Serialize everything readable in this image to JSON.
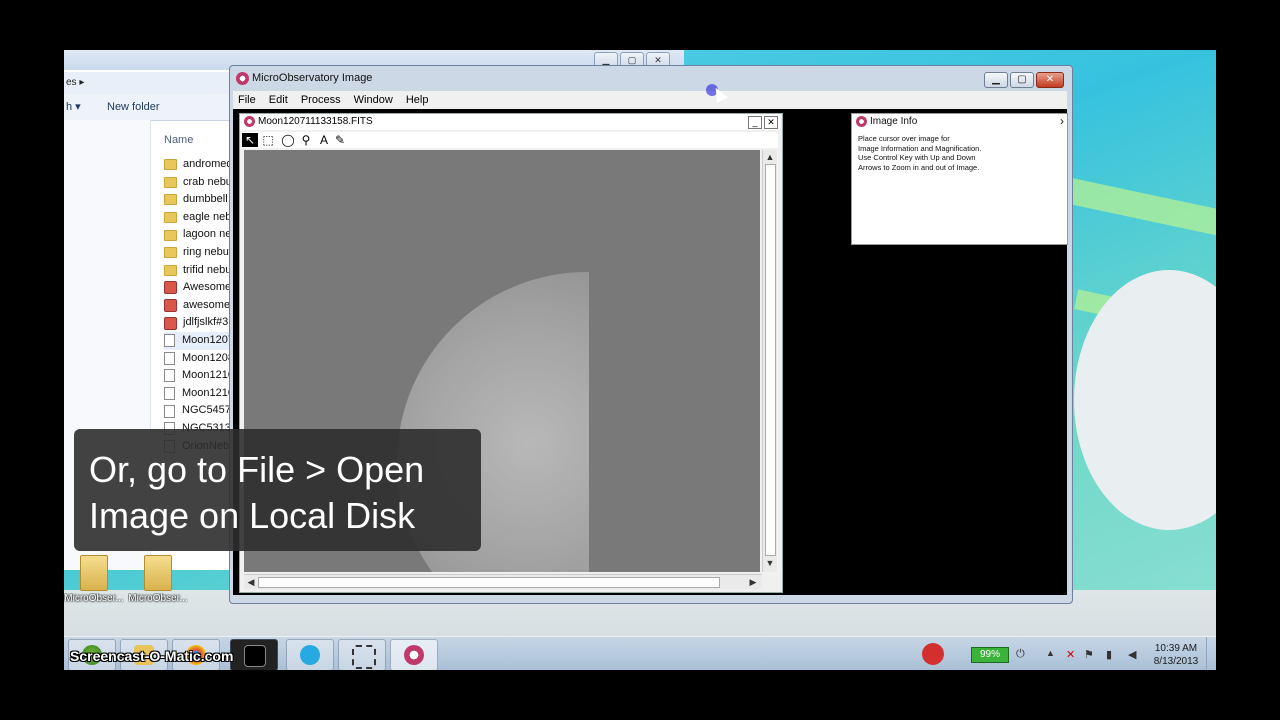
{
  "explorer": {
    "addr_text": "es ▸",
    "toolbar_left": "h ▾",
    "new_folder": "New folder",
    "column_name": "Name",
    "items": [
      {
        "label": "andromed",
        "type": "folder"
      },
      {
        "label": "crab nebu",
        "type": "folder"
      },
      {
        "label": "dumbbell",
        "type": "folder"
      },
      {
        "label": "eagle nebu",
        "type": "folder"
      },
      {
        "label": "lagoon ne",
        "type": "folder"
      },
      {
        "label": "ring nebul",
        "type": "folder"
      },
      {
        "label": "trifid nebu",
        "type": "folder"
      },
      {
        "label": "Awesome",
        "type": "app"
      },
      {
        "label": "awesome",
        "type": "app"
      },
      {
        "label": "jdlfjslkf#3",
        "type": "app"
      },
      {
        "label": "Moon1207",
        "type": "file"
      },
      {
        "label": "Moon1208",
        "type": "file"
      },
      {
        "label": "Moon1210",
        "type": "file"
      },
      {
        "label": "Moon1210",
        "type": "file"
      },
      {
        "label": "NGC5457N",
        "type": "file"
      },
      {
        "label": "NGC5313",
        "type": "file"
      },
      {
        "label": "OrionNeb",
        "type": "file"
      }
    ]
  },
  "desktop_icons": [
    "MicroObser...",
    "MicroObser..."
  ],
  "main_window": {
    "title": "MicroObservatory Image",
    "menu": [
      "File",
      "Edit",
      "Process",
      "Window",
      "Help"
    ],
    "min_glyph": "▁",
    "max_glyph": "▢",
    "close_glyph": "✕"
  },
  "image_window": {
    "title": "Moon120711133158.FITS",
    "min_glyph": "_",
    "close_glyph": "✕",
    "tools": [
      {
        "name": "arrow-tool-icon",
        "glyph": "↖"
      },
      {
        "name": "rect-select-tool-icon",
        "glyph": "⬚"
      },
      {
        "name": "ellipse-tool-icon",
        "glyph": "◯"
      },
      {
        "name": "zoom-tool-icon",
        "glyph": "⚲"
      },
      {
        "name": "text-tool-icon",
        "glyph": "A"
      },
      {
        "name": "pencil-tool-icon",
        "glyph": "✎"
      }
    ],
    "scroll_up": "▲",
    "scroll_down": "▼",
    "scroll_left": "◀",
    "scroll_right": "▶"
  },
  "info_window": {
    "title": "Image Info",
    "arrow": "›",
    "lines": [
      "Place cursor over image for",
      "Image Information and Magnification.",
      "Use Control Key with Up and Down",
      "Arrows to Zoom in and out of Image."
    ]
  },
  "caption": {
    "line1": "Or, go to File > Open",
    "line2": "Image on Local Disk"
  },
  "taskbar": {
    "watermark": "Screencast-O-Matic.com",
    "battery": "99%",
    "time": "10:39 AM",
    "date": "8/13/2013",
    "tray_arrow": "▲",
    "tray_icons": [
      "✕",
      "⚑",
      "▮",
      "◀"
    ]
  }
}
